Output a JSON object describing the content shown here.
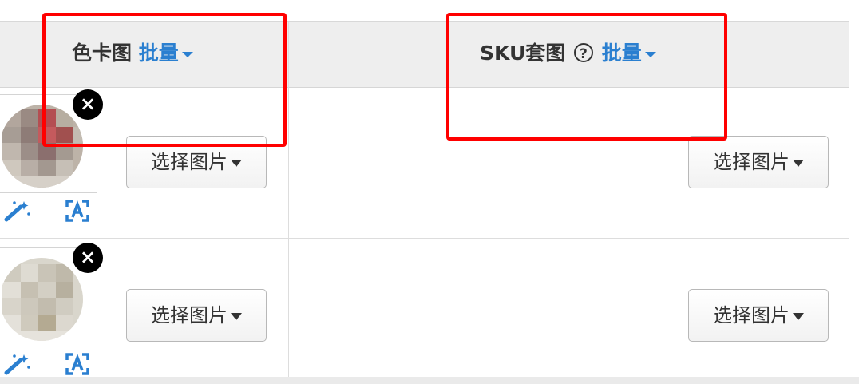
{
  "header": {
    "color_card": {
      "label": "色卡图",
      "batch": "批量"
    },
    "sku_image": {
      "label": "SKU套图",
      "help_icon": "?",
      "batch": "批量"
    }
  },
  "rows": [
    {
      "close_icon": "×",
      "select_color_btn": "选择图片",
      "select_sku_btn": "选择图片"
    },
    {
      "close_icon": "×",
      "select_color_btn": "选择图片",
      "select_sku_btn": "选择图片"
    }
  ],
  "icons": [
    "close-icon",
    "magic-wand-icon",
    "crop-icon",
    "help-icon",
    "caret-down-icon"
  ],
  "colors": {
    "accent": "#2a7fd0",
    "highlight": "#ff0000",
    "header_bg": "#eeeeee",
    "text": "#333333"
  }
}
